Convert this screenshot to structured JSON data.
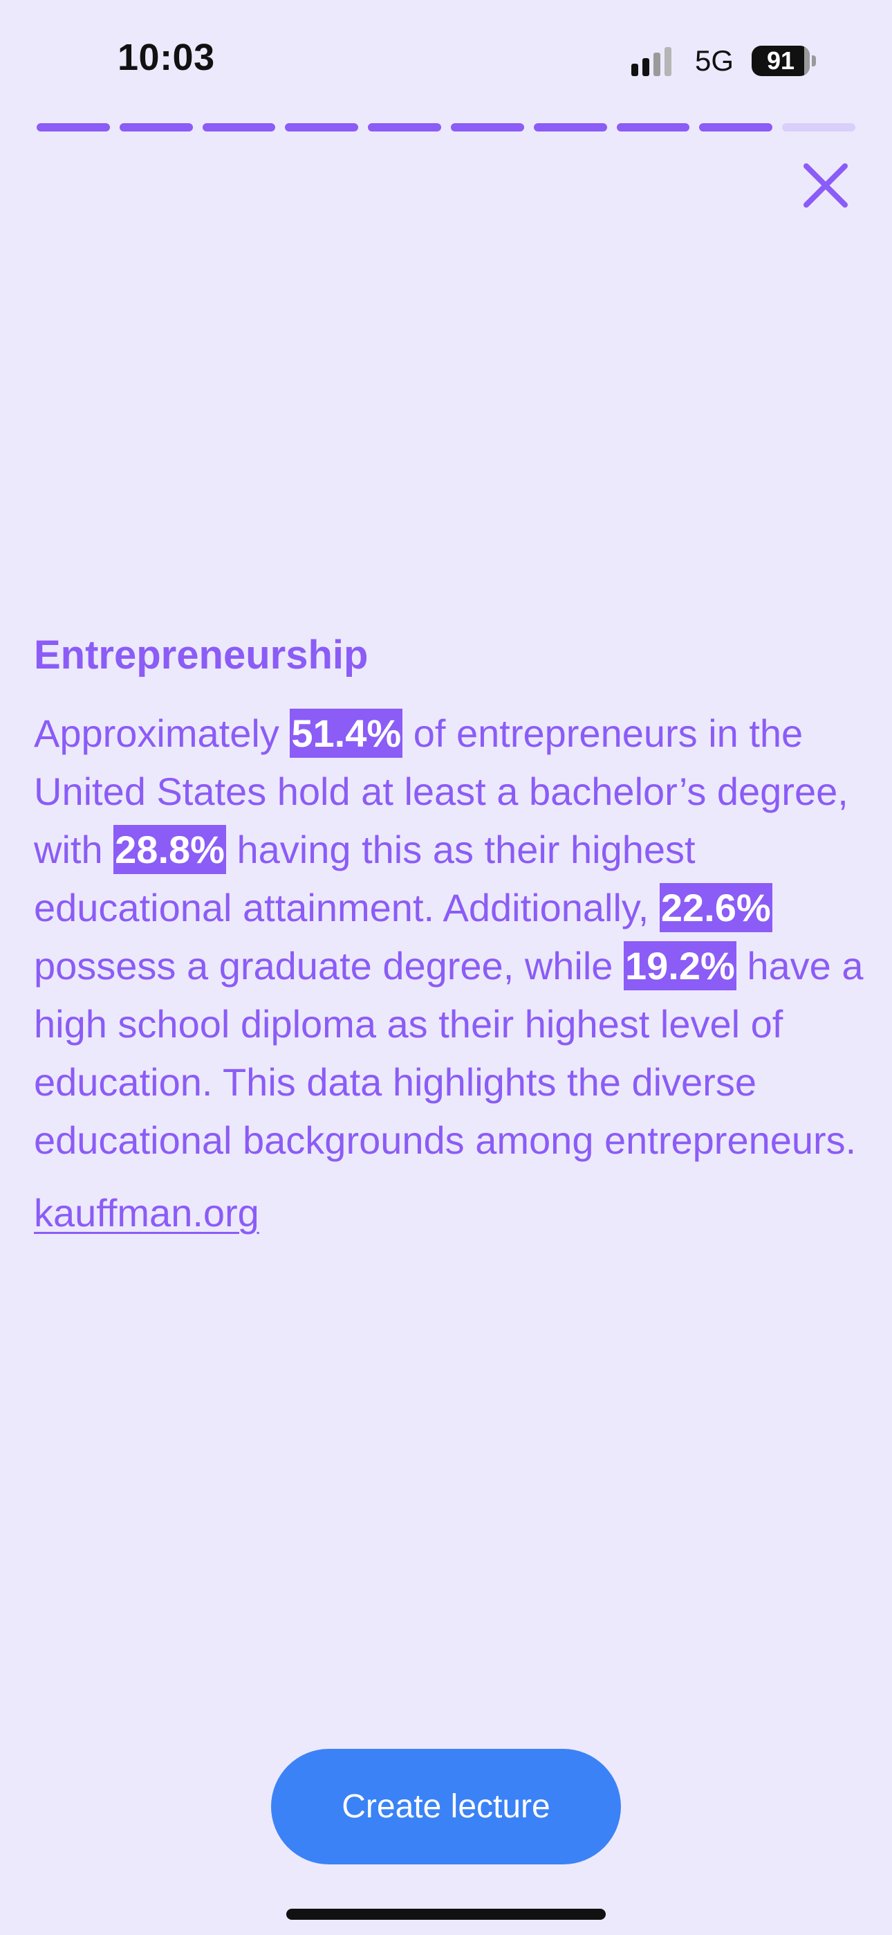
{
  "status_bar": {
    "time": "10:03",
    "network": "5G",
    "battery_percent": "91",
    "signal_strength_fraction": 0.5
  },
  "progress": {
    "total_steps": 10,
    "completed_steps": 9
  },
  "card": {
    "title": "Entrepreneurship",
    "paragraph": [
      {
        "text": "Approximately ",
        "highlight": false
      },
      {
        "text": "51.4%",
        "highlight": true
      },
      {
        "text": " of entrepreneurs in the United States hold at least a bachelor’s degree, with ",
        "highlight": false
      },
      {
        "text": "28.8%",
        "highlight": true
      },
      {
        "text": " having this as their highest educational attainment. Additionally, ",
        "highlight": false
      },
      {
        "text": "22.6%",
        "highlight": true
      },
      {
        "text": " possess a graduate degree, while ",
        "highlight": false
      },
      {
        "text": "19.2%",
        "highlight": true
      },
      {
        "text": " have a high school diploma as their highest level of education. This data highlights the diverse educational backgrounds among entrepreneurs.",
        "highlight": false
      }
    ],
    "source": "kauffman.org"
  },
  "actions": {
    "create_lecture_label": "Create lecture"
  },
  "icons": {
    "close": "close-icon",
    "signal": "cellular-signal-icon",
    "battery": "battery-icon"
  },
  "colors": {
    "background": "#ede9fd",
    "accent": "#8b5cf6",
    "progress_inactive": "#d8cffa",
    "button": "#3b82f6"
  }
}
